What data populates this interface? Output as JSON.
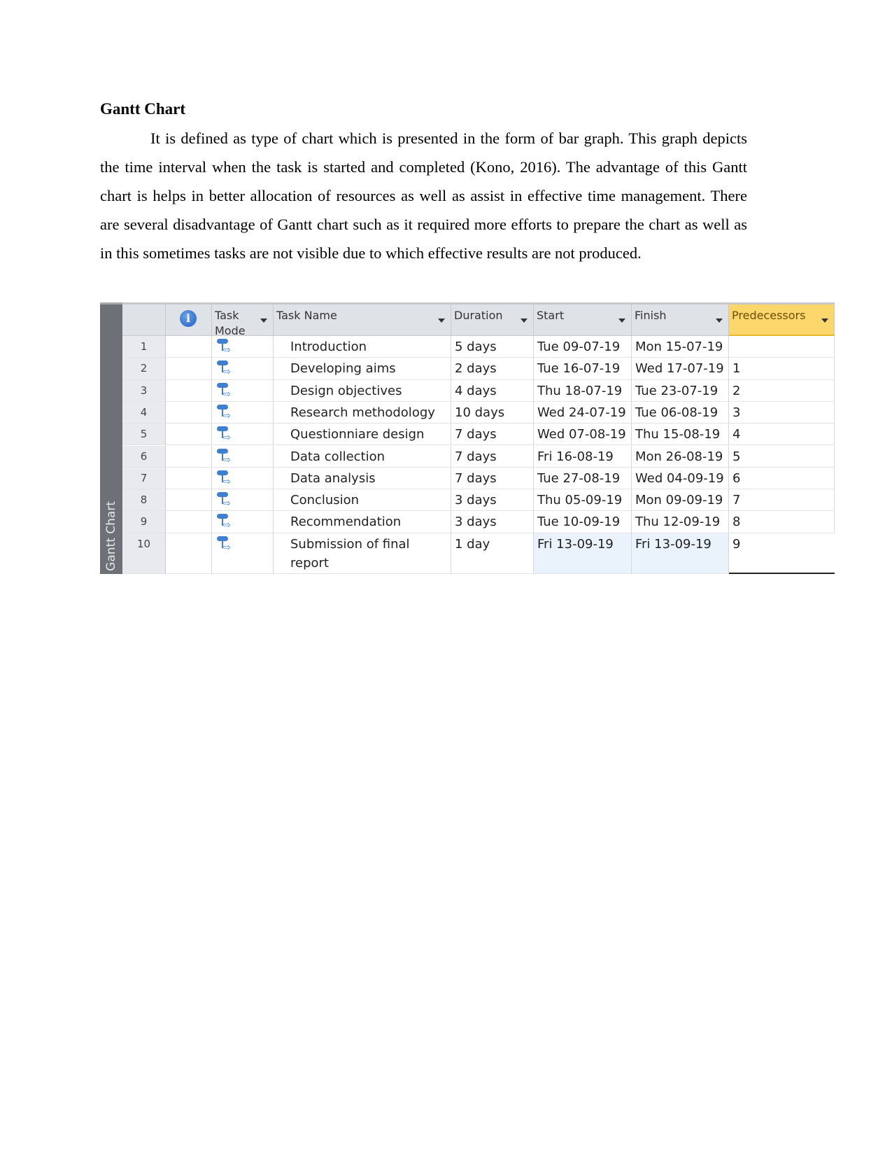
{
  "heading": "Gantt Chart",
  "paragraph": "It is defined as type of chart which is presented in the form of bar graph. This graph depicts the time interval when the task is started and completed (Kono, 2016). The advantage of this Gantt chart is helps in better allocation of resources as well as assist in effective time management. There are several disadvantage of Gantt chart such as it required more efforts to prepare the chart as well as in this sometimes tasks are not visible due to which effective results are not produced.",
  "table": {
    "view_label": "Gantt Chart",
    "info_icon": "i",
    "headers": {
      "task_mode": "Task Mode",
      "task_name": "Task Name",
      "duration": "Duration",
      "start": "Start",
      "finish": "Finish",
      "predecessors": "Predecessors"
    },
    "rows": [
      {
        "id": "1",
        "name": "Introduction",
        "duration": "5 days",
        "start": "Tue 09-07-19",
        "finish": "Mon 15-07-19",
        "pred": ""
      },
      {
        "id": "2",
        "name": "Developing aims",
        "duration": "2 days",
        "start": "Tue 16-07-19",
        "finish": "Wed 17-07-19",
        "pred": "1"
      },
      {
        "id": "3",
        "name": "Design objectives",
        "duration": "4 days",
        "start": "Thu 18-07-19",
        "finish": "Tue 23-07-19",
        "pred": "2"
      },
      {
        "id": "4",
        "name": "Research methodology",
        "duration": "10 days",
        "start": "Wed 24-07-19",
        "finish": "Tue 06-08-19",
        "pred": "3"
      },
      {
        "id": "5",
        "name": "Questionniare design",
        "duration": "7 days",
        "start": "Wed 07-08-19",
        "finish": "Thu 15-08-19",
        "pred": "4"
      },
      {
        "id": "6",
        "name": "Data collection",
        "duration": "7 days",
        "start": "Fri 16-08-19",
        "finish": "Mon 26-08-19",
        "pred": "5"
      },
      {
        "id": "7",
        "name": "Data analysis",
        "duration": "7 days",
        "start": "Tue 27-08-19",
        "finish": "Wed 04-09-19",
        "pred": "6"
      },
      {
        "id": "8",
        "name": "Conclusion",
        "duration": "3 days",
        "start": "Thu 05-09-19",
        "finish": "Mon 09-09-19",
        "pred": "7"
      },
      {
        "id": "9",
        "name": "Recommendation",
        "duration": "3 days",
        "start": "Tue 10-09-19",
        "finish": "Thu 12-09-19",
        "pred": "8"
      },
      {
        "id": "10",
        "name": "Submission of final report",
        "duration": "1 day",
        "start": "Fri 13-09-19",
        "finish": "Fri 13-09-19",
        "pred": "9"
      }
    ]
  }
}
